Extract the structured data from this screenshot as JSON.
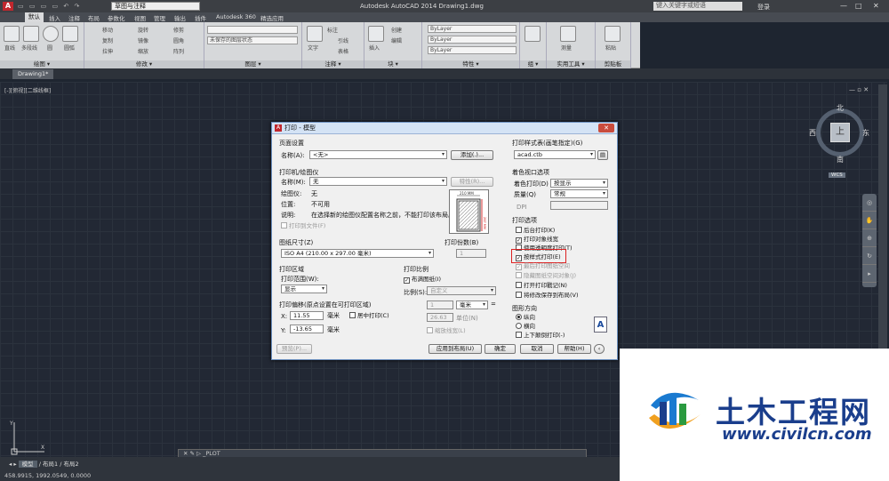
{
  "titlebar": {
    "workspace": "草图与注释",
    "title": "Autodesk AutoCAD 2014    Drawing1.dwg",
    "search_placeholder": "键入关键字或短语",
    "sign_in": "登录",
    "min": "—",
    "max": "□",
    "close": "✕"
  },
  "ribbon_tabs": [
    "默认",
    "插入",
    "注释",
    "布局",
    "参数化",
    "视图",
    "管理",
    "输出",
    "插件",
    "Autodesk 360",
    "精选应用"
  ],
  "ribbon": {
    "draw": {
      "label": "绘图 ▾",
      "line": "直线",
      "polyline": "多段线",
      "circle": "圆",
      "arc": "圆弧"
    },
    "modify": {
      "label": "修改 ▾",
      "move": "移动",
      "rotate": "旋转",
      "trim": "修剪",
      "copy": "复制",
      "mirror": "镜像",
      "fillet": "圆角",
      "stretch": "拉伸",
      "scale": "缩放",
      "array": "阵列"
    },
    "layers": {
      "label": "图层 ▾",
      "state": "未保存的图层状态"
    },
    "annotation": {
      "label": "注释 ▾",
      "text": "文字",
      "dim": "标注",
      "leader": "引线",
      "table": "表格"
    },
    "block": {
      "label": "块 ▾",
      "insert": "插入",
      "create": "创建",
      "edit": "编辑"
    },
    "properties": {
      "label": "特性 ▾",
      "bylayer1": "ByLayer",
      "bylayer2": "ByLayer",
      "bylayer3": "ByLayer"
    },
    "groups": {
      "label": "组 ▾"
    },
    "utilities": {
      "label": "实用工具 ▾",
      "measure": "测量"
    },
    "clipboard": {
      "label": "剪贴板",
      "paste": "粘贴"
    }
  },
  "file_tab": "Drawing1*",
  "viewport_label": "[-][俯视][二维线框]",
  "viewcube": {
    "n": "北",
    "s": "南",
    "e": "东",
    "w": "西",
    "face": "上",
    "wcs": "WCS"
  },
  "command_line": "_PLOT",
  "status": {
    "tabs": [
      "模型",
      "布局1",
      "布局2"
    ],
    "coords": "458.9915, 1992.0549, 0.0000"
  },
  "dialog": {
    "title": "打印 - 模型",
    "page_setup": {
      "section": "页面设置",
      "name_label": "名称(A):",
      "name_value": "<无>",
      "add_button": "添加(.)..."
    },
    "plotter": {
      "section": "打印机/绘图仪",
      "name_label": "名称(M):",
      "name_value": "无",
      "properties_button": "特性(R)...",
      "plotter_label": "绘图仪:",
      "plotter_value": "无",
      "where_label": "位置:",
      "where_value": "不可用",
      "desc_label": "说明:",
      "desc_value": "在选择新的绘图仪配置名称之前，不能打印该布局。",
      "plot_to_file": "打印到文件(F)",
      "preview_dim": "210 MM",
      "preview_dim2": "297 MM"
    },
    "paper_size": {
      "section": "图纸尺寸(Z)",
      "value": "ISO A4 (210.00 x 297.00 毫米)"
    },
    "copies": {
      "section": "打印份数(B)",
      "value": "1"
    },
    "plot_area": {
      "section": "打印区域",
      "what_label": "打印范围(W):",
      "what_value": "显示"
    },
    "plot_offset": {
      "section": "打印偏移(原点设置在可打印区域)",
      "x_label": "X:",
      "x_value": "11.55",
      "x_unit": "毫米",
      "center": "居中打印(C)",
      "y_label": "Y:",
      "y_value": "-13.65",
      "y_unit": "毫米"
    },
    "plot_scale": {
      "section": "打印比例",
      "fit": "布满图纸(I)",
      "scale_label": "比例(S):",
      "scale_value": "自定义",
      "val1": "1",
      "unit": "毫米",
      "eq": "=",
      "val2": "26.63",
      "unit2": "单位(N)",
      "lineweights": "缩放线宽(L)"
    },
    "style_table": {
      "section": "打印样式表(画笔指定)(G)",
      "value": "acad.ctb"
    },
    "shaded": {
      "section": "着色视口选项",
      "shade_label": "着色打印(D)",
      "shade_value": "按显示",
      "quality_label": "质量(Q)",
      "quality_value": "常规",
      "dpi_label": "DPI"
    },
    "options": {
      "section": "打印选项",
      "items": [
        "后台打印(K)",
        "打印对象线宽",
        "使用透明度打印(T)",
        "按样式打印(E)",
        "最后打印图纸空间",
        "隐藏图纸空间对象(J)",
        "打开打印戳记(N)",
        "将修改保存到布局(V)"
      ]
    },
    "orientation": {
      "section": "图形方向",
      "portrait": "纵向",
      "landscape": "横向",
      "upside": "上下颠倒打印(-)",
      "icon": "A"
    },
    "buttons": {
      "preview": "预览(P)...",
      "apply": "应用到布局(U)",
      "ok": "确定",
      "cancel": "取消",
      "help": "帮助(H)",
      "more": "‹"
    }
  },
  "watermark": {
    "name": "土木工程网",
    "url": "www.civilcn.com"
  },
  "colors": {
    "accent": "#1a3e8c",
    "titlebar": "#3c3f44",
    "canvas": "#222834",
    "highlight": "#dd2222"
  }
}
